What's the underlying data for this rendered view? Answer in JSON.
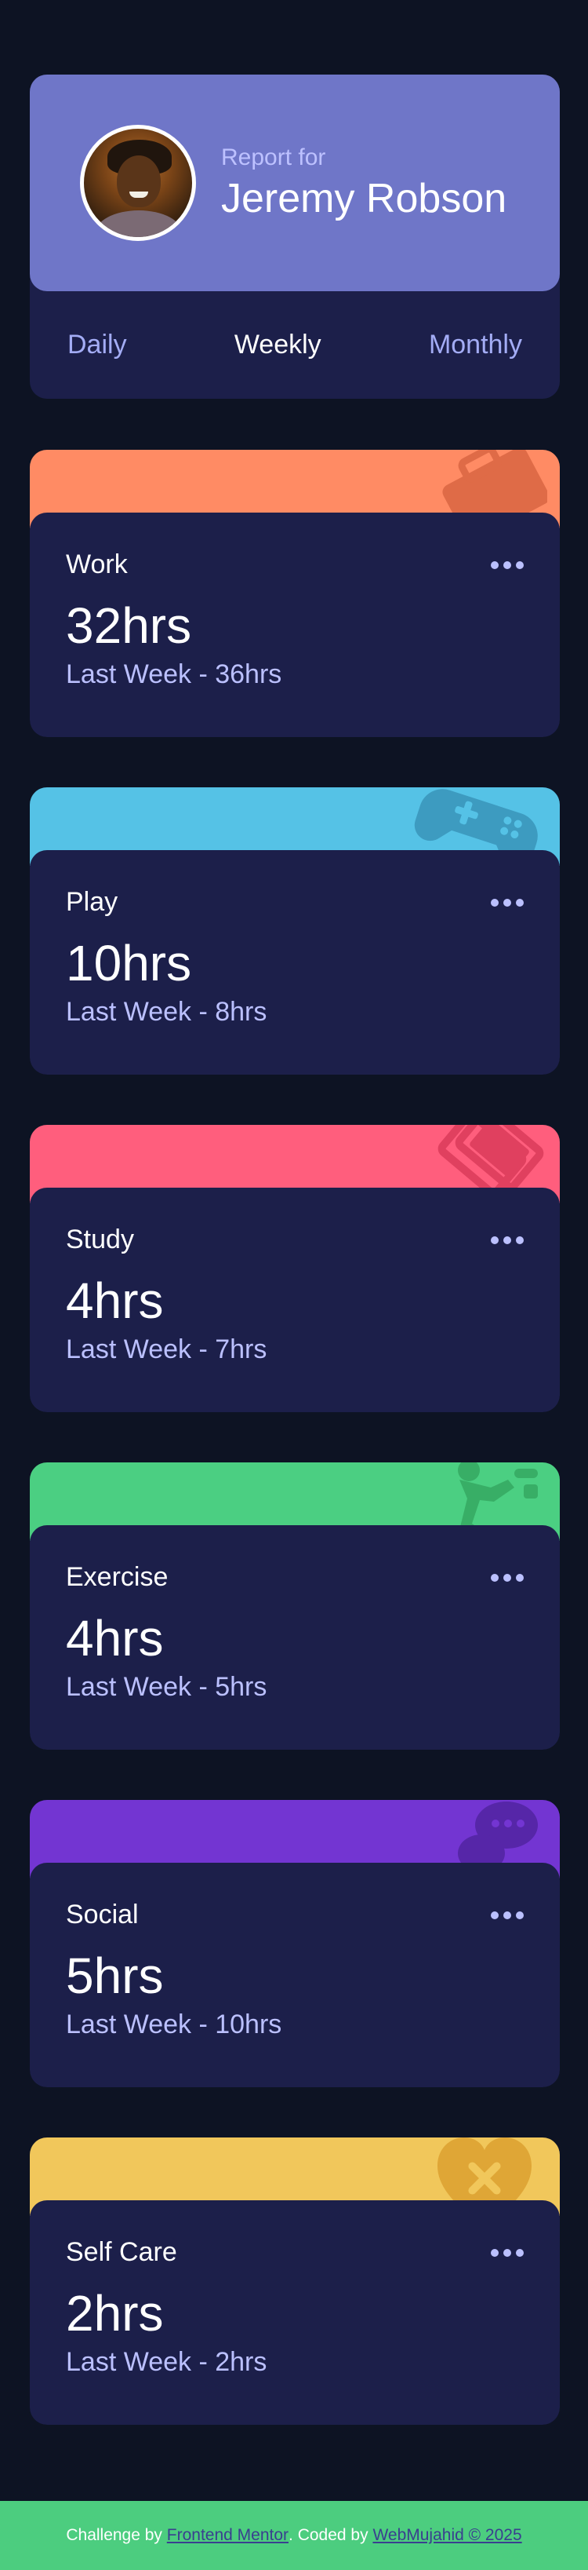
{
  "profile": {
    "report_label": "Report for",
    "name": "Jeremy Robson",
    "tabs": [
      {
        "label": "Daily",
        "active": false
      },
      {
        "label": "Weekly",
        "active": true
      },
      {
        "label": "Monthly",
        "active": false
      }
    ]
  },
  "activities": [
    {
      "title": "Work",
      "current": "32hrs",
      "previous": "Last Week - 36hrs",
      "color": "#ff8b64",
      "icon": "briefcase-icon"
    },
    {
      "title": "Play",
      "current": "10hrs",
      "previous": "Last Week - 8hrs",
      "color": "#55c2e6",
      "icon": "gamepad-icon"
    },
    {
      "title": "Study",
      "current": "4hrs",
      "previous": "Last Week - 7hrs",
      "color": "#ff5e7d",
      "icon": "book-icon"
    },
    {
      "title": "Exercise",
      "current": "4hrs",
      "previous": "Last Week - 5hrs",
      "color": "#4bcf82",
      "icon": "running-icon"
    },
    {
      "title": "Social",
      "current": "5hrs",
      "previous": "Last Week - 10hrs",
      "color": "#7335d2",
      "icon": "chat-icon"
    },
    {
      "title": "Self Care",
      "current": "2hrs",
      "previous": "Last Week - 2hrs",
      "color": "#f1c75b",
      "icon": "heart-icon"
    }
  ],
  "footer": {
    "prefix": "Challenge by",
    "link1": "Frontend Mentor",
    "middle": ". Coded by",
    "link2": "WebMujahid © 2025"
  },
  "colors": {
    "background": "#0d1323",
    "card": "#1c1f4a",
    "profile_accent": "#6f76c8",
    "footer": "#4ccd7f"
  }
}
